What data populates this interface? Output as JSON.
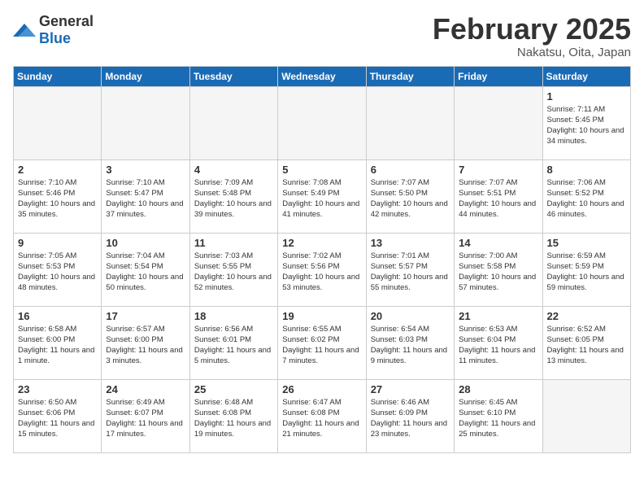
{
  "header": {
    "logo": {
      "general": "General",
      "blue": "Blue"
    },
    "title": "February 2025",
    "location": "Nakatsu, Oita, Japan"
  },
  "weekdays": [
    "Sunday",
    "Monday",
    "Tuesday",
    "Wednesday",
    "Thursday",
    "Friday",
    "Saturday"
  ],
  "weeks": [
    [
      {
        "day": "",
        "info": ""
      },
      {
        "day": "",
        "info": ""
      },
      {
        "day": "",
        "info": ""
      },
      {
        "day": "",
        "info": ""
      },
      {
        "day": "",
        "info": ""
      },
      {
        "day": "",
        "info": ""
      },
      {
        "day": "1",
        "info": "Sunrise: 7:11 AM\nSunset: 5:45 PM\nDaylight: 10 hours and 34 minutes."
      }
    ],
    [
      {
        "day": "2",
        "info": "Sunrise: 7:10 AM\nSunset: 5:46 PM\nDaylight: 10 hours and 35 minutes."
      },
      {
        "day": "3",
        "info": "Sunrise: 7:10 AM\nSunset: 5:47 PM\nDaylight: 10 hours and 37 minutes."
      },
      {
        "day": "4",
        "info": "Sunrise: 7:09 AM\nSunset: 5:48 PM\nDaylight: 10 hours and 39 minutes."
      },
      {
        "day": "5",
        "info": "Sunrise: 7:08 AM\nSunset: 5:49 PM\nDaylight: 10 hours and 41 minutes."
      },
      {
        "day": "6",
        "info": "Sunrise: 7:07 AM\nSunset: 5:50 PM\nDaylight: 10 hours and 42 minutes."
      },
      {
        "day": "7",
        "info": "Sunrise: 7:07 AM\nSunset: 5:51 PM\nDaylight: 10 hours and 44 minutes."
      },
      {
        "day": "8",
        "info": "Sunrise: 7:06 AM\nSunset: 5:52 PM\nDaylight: 10 hours and 46 minutes."
      }
    ],
    [
      {
        "day": "9",
        "info": "Sunrise: 7:05 AM\nSunset: 5:53 PM\nDaylight: 10 hours and 48 minutes."
      },
      {
        "day": "10",
        "info": "Sunrise: 7:04 AM\nSunset: 5:54 PM\nDaylight: 10 hours and 50 minutes."
      },
      {
        "day": "11",
        "info": "Sunrise: 7:03 AM\nSunset: 5:55 PM\nDaylight: 10 hours and 52 minutes."
      },
      {
        "day": "12",
        "info": "Sunrise: 7:02 AM\nSunset: 5:56 PM\nDaylight: 10 hours and 53 minutes."
      },
      {
        "day": "13",
        "info": "Sunrise: 7:01 AM\nSunset: 5:57 PM\nDaylight: 10 hours and 55 minutes."
      },
      {
        "day": "14",
        "info": "Sunrise: 7:00 AM\nSunset: 5:58 PM\nDaylight: 10 hours and 57 minutes."
      },
      {
        "day": "15",
        "info": "Sunrise: 6:59 AM\nSunset: 5:59 PM\nDaylight: 10 hours and 59 minutes."
      }
    ],
    [
      {
        "day": "16",
        "info": "Sunrise: 6:58 AM\nSunset: 6:00 PM\nDaylight: 11 hours and 1 minute."
      },
      {
        "day": "17",
        "info": "Sunrise: 6:57 AM\nSunset: 6:00 PM\nDaylight: 11 hours and 3 minutes."
      },
      {
        "day": "18",
        "info": "Sunrise: 6:56 AM\nSunset: 6:01 PM\nDaylight: 11 hours and 5 minutes."
      },
      {
        "day": "19",
        "info": "Sunrise: 6:55 AM\nSunset: 6:02 PM\nDaylight: 11 hours and 7 minutes."
      },
      {
        "day": "20",
        "info": "Sunrise: 6:54 AM\nSunset: 6:03 PM\nDaylight: 11 hours and 9 minutes."
      },
      {
        "day": "21",
        "info": "Sunrise: 6:53 AM\nSunset: 6:04 PM\nDaylight: 11 hours and 11 minutes."
      },
      {
        "day": "22",
        "info": "Sunrise: 6:52 AM\nSunset: 6:05 PM\nDaylight: 11 hours and 13 minutes."
      }
    ],
    [
      {
        "day": "23",
        "info": "Sunrise: 6:50 AM\nSunset: 6:06 PM\nDaylight: 11 hours and 15 minutes."
      },
      {
        "day": "24",
        "info": "Sunrise: 6:49 AM\nSunset: 6:07 PM\nDaylight: 11 hours and 17 minutes."
      },
      {
        "day": "25",
        "info": "Sunrise: 6:48 AM\nSunset: 6:08 PM\nDaylight: 11 hours and 19 minutes."
      },
      {
        "day": "26",
        "info": "Sunrise: 6:47 AM\nSunset: 6:08 PM\nDaylight: 11 hours and 21 minutes."
      },
      {
        "day": "27",
        "info": "Sunrise: 6:46 AM\nSunset: 6:09 PM\nDaylight: 11 hours and 23 minutes."
      },
      {
        "day": "28",
        "info": "Sunrise: 6:45 AM\nSunset: 6:10 PM\nDaylight: 11 hours and 25 minutes."
      },
      {
        "day": "",
        "info": ""
      }
    ]
  ]
}
